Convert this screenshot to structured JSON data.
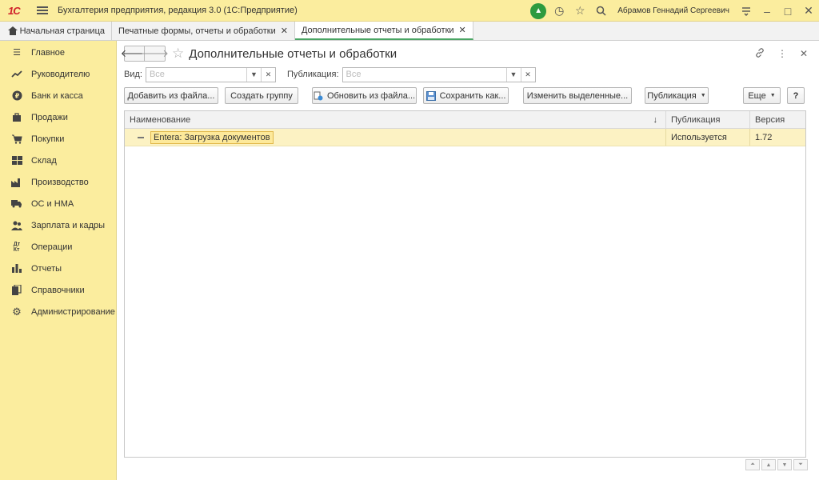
{
  "titlebar": {
    "logo": "1С",
    "app_title": "Бухгалтерия предприятия, редакция 3.0  (1С:Предприятие)",
    "username": "Абрамов Геннадий Сергеевич"
  },
  "tabs": [
    {
      "label": "Начальная страница"
    },
    {
      "label": "Печатные формы, отчеты и обработки"
    },
    {
      "label": "Дополнительные отчеты и обработки"
    }
  ],
  "sidebar": {
    "items": [
      {
        "label": "Главное",
        "icon": "menu-lines-icon"
      },
      {
        "label": "Руководителю",
        "icon": "trend-icon"
      },
      {
        "label": "Банк и касса",
        "icon": "ruble-coin-icon"
      },
      {
        "label": "Продажи",
        "icon": "shopping-bag-icon"
      },
      {
        "label": "Покупки",
        "icon": "cart-icon"
      },
      {
        "label": "Склад",
        "icon": "warehouse-grid-icon"
      },
      {
        "label": "Производство",
        "icon": "factory-icon"
      },
      {
        "label": "ОС и НМА",
        "icon": "truck-icon"
      },
      {
        "label": "Зарплата и кадры",
        "icon": "people-icon"
      },
      {
        "label": "Операции",
        "icon": "debit-credit-icon"
      },
      {
        "label": "Отчеты",
        "icon": "bar-chart-icon"
      },
      {
        "label": "Справочники",
        "icon": "books-icon"
      },
      {
        "label": "Администрирование",
        "icon": "gear-icon"
      }
    ]
  },
  "main": {
    "title": "Дополнительные отчеты и обработки",
    "filters": {
      "vid_label": "Вид:",
      "vid_placeholder": "Все",
      "pub_label": "Публикация:",
      "pub_placeholder": "Все"
    },
    "toolbar": {
      "add_from_file": "Добавить из файла...",
      "create_group": "Создать группу",
      "update_from_file": "Обновить из файла...",
      "save_as": "Сохранить как...",
      "change_selected": "Изменить выделенные...",
      "publication": "Публикация",
      "more": "Еще",
      "help": "?"
    },
    "table": {
      "columns": [
        "Наименование",
        "Публикация",
        "Версия"
      ],
      "sort_indicator": "↓",
      "rows": [
        {
          "name": "Entera: Загрузка документов",
          "publication": "Используется",
          "version": "1.72"
        }
      ]
    }
  }
}
